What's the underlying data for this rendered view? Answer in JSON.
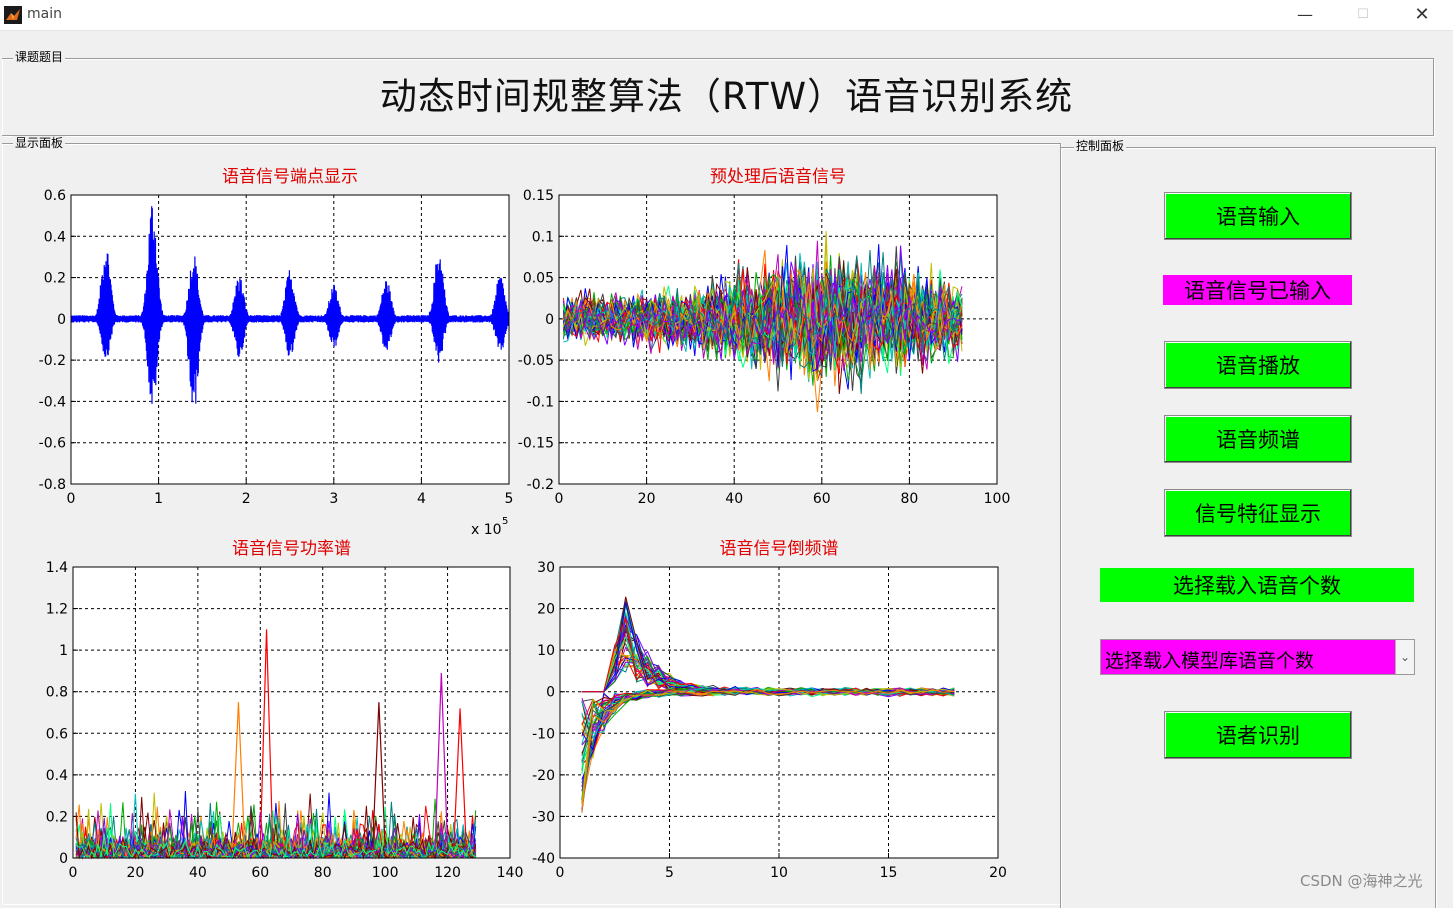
{
  "window": {
    "title": "main",
    "icon": "matlab-icon"
  },
  "groups": {
    "topic": "课题题目",
    "display": "显示面板",
    "control": "控制面板"
  },
  "main_title": "动态时间规整算法（RTW）语音识别系统",
  "controls": {
    "voice_input": "语音输入",
    "status": "语音信号已输入",
    "play": "语音播放",
    "spectrum": "语音频谱",
    "features": "信号特征显示",
    "select_count": "选择载入语音个数",
    "model_select": "选择载入模型库语音个数",
    "recognize": "语者识别"
  },
  "watermark": "CSDN @海神之光",
  "colors": {
    "button_green": "#00ff00",
    "status_magenta": "#ff00ff",
    "title_red": "#e00000",
    "signal_blue": "#0000ff"
  },
  "chart_data": [
    {
      "id": "endpoint",
      "type": "line",
      "title": "语音信号端点显示",
      "xlim": [
        0,
        5
      ],
      "ylim": [
        -0.8,
        0.6
      ],
      "xticks": [
        "0",
        "1",
        "2",
        "3",
        "4",
        "5"
      ],
      "yticks": [
        "-0.8",
        "-0.6",
        "-0.4",
        "-0.2",
        "0",
        "0.2",
        "0.4",
        "0.6"
      ],
      "x_multiplier": "x 10",
      "x_multiplier_exp": "5",
      "grid": true,
      "series": [
        {
          "color": "#0000ff",
          "bursts": [
            [
              0.4,
              0.38,
              -0.2
            ],
            [
              0.93,
              0.6,
              -0.45
            ],
            [
              1.4,
              0.33,
              -0.48
            ],
            [
              1.92,
              0.22,
              -0.2
            ],
            [
              2.5,
              0.25,
              -0.2
            ],
            [
              3.0,
              0.17,
              -0.15
            ],
            [
              3.6,
              0.2,
              -0.17
            ],
            [
              4.2,
              0.35,
              -0.22
            ],
            [
              4.9,
              0.22,
              -0.18
            ]
          ]
        }
      ]
    },
    {
      "id": "preprocessed",
      "type": "line",
      "title": "预处理后语音信号",
      "xlim": [
        0,
        100
      ],
      "ylim": [
        -0.2,
        0.15
      ],
      "xticks": [
        "0",
        "20",
        "40",
        "60",
        "80",
        "100"
      ],
      "yticks": [
        "-0.2",
        "-0.15",
        "-0.1",
        "-0.05",
        "0",
        "0.05",
        "0.1",
        "0.15"
      ],
      "grid": true,
      "x_end": 92,
      "amplitude_peak": 0.13
    },
    {
      "id": "power",
      "type": "line",
      "title": "语音信号功率谱",
      "xlim": [
        0,
        140
      ],
      "ylim": [
        0,
        1.4
      ],
      "xticks": [
        "0",
        "20",
        "40",
        "60",
        "80",
        "100",
        "120",
        "140"
      ],
      "yticks": [
        "0",
        "0.2",
        "0.4",
        "0.6",
        "0.8",
        "1",
        "1.2",
        "1.4"
      ],
      "grid": true,
      "x_end": 129,
      "peaks": [
        [
          62,
          1.1
        ],
        [
          118,
          0.89
        ],
        [
          53,
          0.75
        ],
        [
          98,
          0.75
        ],
        [
          124,
          0.72
        ]
      ]
    },
    {
      "id": "cepstrum",
      "type": "line",
      "title": "语音信号倒频谱",
      "xlim": [
        0,
        20
      ],
      "ylim": [
        -40,
        30
      ],
      "xticks": [
        "0",
        "5",
        "10",
        "15",
        "20"
      ],
      "yticks": [
        "-40",
        "-30",
        "-20",
        "-10",
        "0",
        "10",
        "20",
        "30"
      ],
      "grid": true,
      "x_start": 1,
      "x_end": 18,
      "peak": [
        3,
        23
      ],
      "trough": [
        1,
        -30
      ]
    }
  ]
}
